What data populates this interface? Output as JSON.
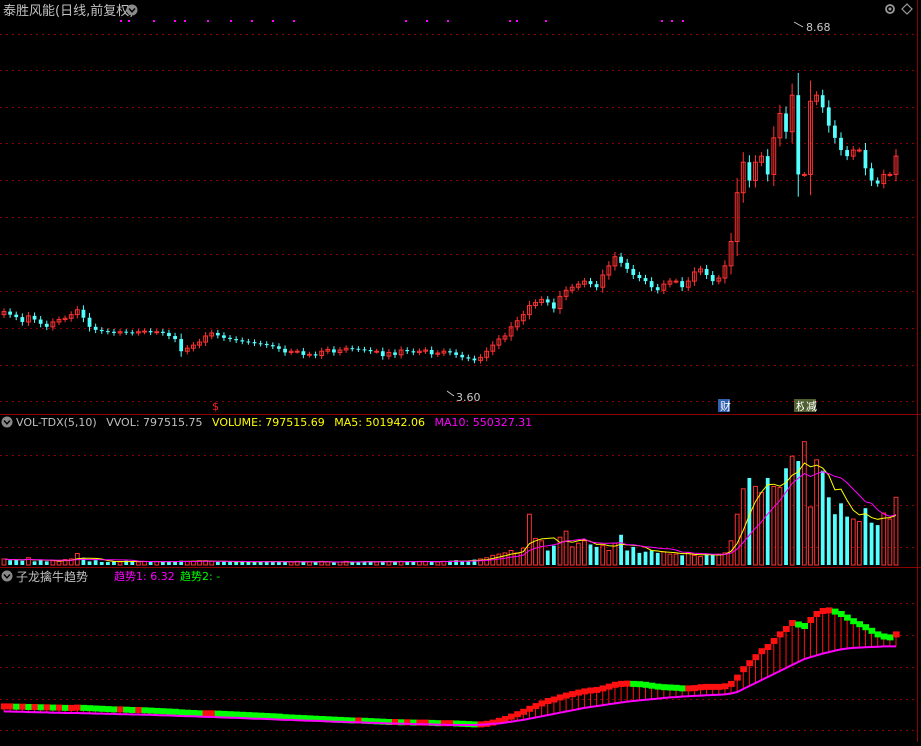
{
  "header": {
    "title": "泰胜风能(日线,前复权)",
    "right_icons": [
      "gear-icon",
      "diamond-icon"
    ]
  },
  "price_panel": {
    "high_label": "8.68",
    "low_label": "3.60",
    "events": [
      {
        "label": "$",
        "color": "#ff2020"
      },
      {
        "label": "财",
        "color": "#ffffff"
      },
      {
        "label": "权",
        "color": "#ffffff"
      },
      {
        "label": "减",
        "color": "#ffffff"
      }
    ]
  },
  "vol_panel": {
    "title": "VOL-TDX(5,10)",
    "vvol": "VVOL: 797515.75",
    "volume": "VOLUME: 797515.69",
    "ma5": "MA5: 501942.06",
    "ma10": "MA10: 550327.31"
  },
  "trend_panel": {
    "title": "子龙擒牛趋势",
    "trend1": "趋势1: 6.32",
    "trend2": "趋势2: -"
  },
  "colors": {
    "up": "#ff3232",
    "down": "#54ffff",
    "grid": "#8b0000",
    "ma5": "#ffff00",
    "ma10": "#ff00ff",
    "trend_line": "#ff00ff",
    "trend_up_box": "#ff1010",
    "trend_down_box": "#00ff00",
    "title_text": "#c0c0c0",
    "volume_text": "#ffff00",
    "trend2_text": "#00ff00"
  },
  "chart_data": [
    {
      "type": "candlestick",
      "name": "price",
      "ymin": 3.0,
      "ymax": 9.2,
      "series": [
        {
          "name": "close",
          "values": [
            4.45,
            4.4,
            4.36,
            4.28,
            4.38,
            4.32,
            4.25,
            4.2,
            4.28,
            4.32,
            4.34,
            4.4,
            4.48,
            4.35,
            4.2,
            4.15,
            4.13,
            4.12,
            4.1,
            4.12,
            4.11,
            4.1,
            4.12,
            4.13,
            4.11,
            4.12,
            4.1,
            4.05,
            4.0,
            3.8,
            3.85,
            3.9,
            3.95,
            4.05,
            4.1,
            4.06,
            4.02,
            4.0,
            3.98,
            3.96,
            3.95,
            3.93,
            3.92,
            3.9,
            3.88,
            3.84,
            3.78,
            3.8,
            3.8,
            3.74,
            3.75,
            3.73,
            3.8,
            3.83,
            3.78,
            3.82,
            3.85,
            3.84,
            3.83,
            3.82,
            3.8,
            3.8,
            3.72,
            3.78,
            3.74,
            3.82,
            3.8,
            3.78,
            3.8,
            3.82,
            3.75,
            3.77,
            3.8,
            3.78,
            3.74,
            3.7,
            3.68,
            3.65,
            3.7,
            3.8,
            3.9,
            4.0,
            4.05,
            4.2,
            4.3,
            4.4,
            4.55,
            4.6,
            4.65,
            4.6,
            4.5,
            4.7,
            4.8,
            4.85,
            4.9,
            4.95,
            4.9,
            4.85,
            5.05,
            5.2,
            5.35,
            5.25,
            5.15,
            5.05,
            5.0,
            4.95,
            4.85,
            4.8,
            4.9,
            4.95,
            4.95,
            4.85,
            4.95,
            5.1,
            5.15,
            5.05,
            4.95,
            5.0,
            5.2,
            5.6,
            6.4,
            6.9,
            6.6,
            6.9,
            7.0,
            6.7,
            7.3,
            7.7,
            7.4,
            8.0,
            6.7,
            6.7,
            7.9,
            8.0,
            7.8,
            7.5,
            7.3,
            7.1,
            7.0,
            7.1,
            7.1,
            6.8,
            6.6,
            6.55,
            6.7,
            6.7,
            7.0
          ]
        },
        {
          "name": "open",
          "values": [
            4.4,
            4.45,
            4.4,
            4.36,
            4.28,
            4.38,
            4.32,
            4.25,
            4.2,
            4.28,
            4.32,
            4.34,
            4.4,
            4.48,
            4.35,
            4.2,
            4.15,
            4.13,
            4.12,
            4.1,
            4.12,
            4.11,
            4.1,
            4.12,
            4.13,
            4.11,
            4.12,
            4.1,
            4.05,
            4.0,
            3.8,
            3.85,
            3.9,
            3.95,
            4.05,
            4.1,
            4.06,
            4.02,
            4.0,
            3.98,
            3.96,
            3.95,
            3.93,
            3.92,
            3.9,
            3.88,
            3.84,
            3.78,
            3.8,
            3.8,
            3.74,
            3.75,
            3.73,
            3.8,
            3.83,
            3.78,
            3.82,
            3.85,
            3.84,
            3.83,
            3.82,
            3.8,
            3.8,
            3.72,
            3.78,
            3.74,
            3.82,
            3.8,
            3.78,
            3.8,
            3.82,
            3.75,
            3.77,
            3.8,
            3.78,
            3.74,
            3.7,
            3.68,
            3.65,
            3.7,
            3.8,
            3.9,
            4.0,
            4.05,
            4.2,
            4.3,
            4.4,
            4.55,
            4.6,
            4.65,
            4.6,
            4.5,
            4.7,
            4.8,
            4.85,
            4.9,
            4.95,
            4.9,
            4.85,
            5.05,
            5.2,
            5.35,
            5.25,
            5.15,
            5.05,
            5.0,
            4.95,
            4.85,
            4.8,
            4.9,
            4.95,
            4.95,
            4.85,
            4.95,
            5.1,
            5.15,
            5.05,
            4.95,
            5.0,
            5.2,
            5.6,
            6.4,
            6.9,
            6.6,
            6.9,
            7.0,
            6.7,
            7.3,
            7.7,
            7.4,
            8.0,
            6.7,
            6.7,
            7.9,
            8.0,
            7.8,
            7.5,
            7.3,
            7.1,
            7.0,
            7.1,
            7.1,
            6.8,
            6.6,
            6.55,
            6.7,
            6.7
          ]
        }
      ]
    },
    {
      "type": "bar",
      "name": "volume",
      "ymax": 1100000,
      "series": [
        {
          "name": "VOLUME",
          "values": [
            50000,
            40000,
            45000,
            35000,
            60000,
            30000,
            40000,
            30000,
            35000,
            30000,
            45000,
            50000,
            95000,
            60000,
            30000,
            40000,
            25000,
            25000,
            30000,
            25000,
            35000,
            30000,
            25000,
            30000,
            25000,
            30000,
            25000,
            30000,
            30000,
            35000,
            30000,
            30000,
            35000,
            35000,
            30000,
            25000,
            30000,
            25000,
            25000,
            30000,
            25000,
            25000,
            30000,
            30000,
            30000,
            25000,
            25000,
            25000,
            30000,
            30000,
            25000,
            25000,
            30000,
            25000,
            20000,
            25000,
            30000,
            25000,
            25000,
            30000,
            30000,
            25000,
            30000,
            30000,
            25000,
            30000,
            30000,
            25000,
            30000,
            30000,
            30000,
            25000,
            30000,
            35000,
            40000,
            30000,
            35000,
            45000,
            50000,
            60000,
            80000,
            90000,
            100000,
            120000,
            100000,
            140000,
            420000,
            220000,
            200000,
            120000,
            160000,
            230000,
            280000,
            150000,
            180000,
            200000,
            170000,
            150000,
            160000,
            120000,
            180000,
            250000,
            120000,
            150000,
            100000,
            110000,
            120000,
            100000,
            110000,
            90000,
            90000,
            80000,
            100000,
            80000,
            70000,
            90000,
            85000,
            90000,
            100000,
            200000,
            420000,
            630000,
            720000,
            650000,
            600000,
            720000,
            650000,
            640000,
            800000,
            900000,
            860000,
            1020000,
            480000,
            870000,
            780000,
            560000,
            420000,
            510000,
            400000,
            380000,
            360000,
            470000,
            350000,
            330000,
            430000,
            380000,
            560000
          ]
        }
      ]
    },
    {
      "type": "line",
      "name": "trend",
      "ymin": 3.2,
      "ymax": 8.2,
      "series": [
        {
          "name": "趋势1",
          "values": [
            4.15,
            4.15,
            4.14,
            4.14,
            4.13,
            4.13,
            4.12,
            4.12,
            4.11,
            4.11,
            4.1,
            4.1,
            4.1,
            4.09,
            4.09,
            4.08,
            4.08,
            4.07,
            4.07,
            4.06,
            4.06,
            4.05,
            4.05,
            4.04,
            4.04,
            4.03,
            4.02,
            4.02,
            4.01,
            4.0,
            3.99,
            3.99,
            3.98,
            3.97,
            3.97,
            3.96,
            3.95,
            3.94,
            3.94,
            3.93,
            3.92,
            3.91,
            3.91,
            3.9,
            3.89,
            3.88,
            3.87,
            3.87,
            3.86,
            3.85,
            3.84,
            3.84,
            3.83,
            3.82,
            3.81,
            3.81,
            3.8,
            3.79,
            3.79,
            3.78,
            3.77,
            3.77,
            3.76,
            3.75,
            3.75,
            3.74,
            3.74,
            3.73,
            3.73,
            3.72,
            3.72,
            3.71,
            3.71,
            3.7,
            3.7,
            3.7,
            3.7,
            3.7,
            3.71,
            3.72,
            3.74,
            3.75,
            3.78,
            3.81,
            3.84,
            3.87,
            3.91,
            3.95,
            3.99,
            4.03,
            4.07,
            4.11,
            4.15,
            4.19,
            4.23,
            4.27,
            4.3,
            4.33,
            4.36,
            4.39,
            4.42,
            4.45,
            4.48,
            4.5,
            4.52,
            4.54,
            4.56,
            4.58,
            4.6,
            4.62,
            4.63,
            4.65,
            4.66,
            4.67,
            4.68,
            4.69,
            4.7,
            4.71,
            4.72,
            4.75,
            4.8,
            4.9,
            5.0,
            5.1,
            5.2,
            5.3,
            5.4,
            5.5,
            5.6,
            5.7,
            5.8,
            5.9,
            5.96,
            6.02,
            6.08,
            6.13,
            6.18,
            6.22,
            6.25,
            6.27,
            6.28,
            6.29,
            6.3,
            6.31,
            6.32,
            6.32,
            6.32
          ]
        },
        {
          "name": "趋势2",
          "values": [
            4.32,
            4.32,
            4.31,
            4.31,
            4.3,
            4.3,
            4.29,
            4.29,
            4.28,
            4.28,
            4.27,
            4.27,
            4.28,
            4.27,
            4.26,
            4.25,
            4.24,
            4.23,
            4.22,
            4.22,
            4.21,
            4.2,
            4.2,
            4.19,
            4.18,
            4.17,
            4.16,
            4.15,
            4.14,
            4.12,
            4.11,
            4.1,
            4.09,
            4.09,
            4.09,
            4.08,
            4.07,
            4.06,
            4.05,
            4.04,
            4.03,
            4.02,
            4.01,
            4.0,
            3.99,
            3.98,
            3.96,
            3.95,
            3.94,
            3.93,
            3.92,
            3.91,
            3.9,
            3.89,
            3.88,
            3.87,
            3.86,
            3.85,
            3.85,
            3.84,
            3.83,
            3.82,
            3.81,
            3.8,
            3.8,
            3.79,
            3.79,
            3.78,
            3.78,
            3.78,
            3.77,
            3.76,
            3.76,
            3.76,
            3.75,
            3.74,
            3.73,
            3.72,
            3.72,
            3.74,
            3.78,
            3.84,
            3.9,
            3.98,
            4.06,
            4.14,
            4.24,
            4.33,
            4.42,
            4.5,
            4.55,
            4.62,
            4.68,
            4.73,
            4.78,
            4.82,
            4.85,
            4.87,
            4.92,
            4.98,
            5.04,
            5.07,
            5.08,
            5.07,
            5.06,
            5.04,
            5.01,
            4.98,
            4.96,
            4.95,
            4.94,
            4.92,
            4.92,
            4.93,
            4.96,
            4.97,
            4.97,
            4.97,
            4.99,
            5.07,
            5.28,
            5.56,
            5.76,
            5.96,
            6.16,
            6.3,
            6.5,
            6.72,
            6.9,
            7.1,
            7.05,
            7.0,
            7.2,
            7.4,
            7.5,
            7.52,
            7.48,
            7.4,
            7.28,
            7.16,
            7.06,
            6.96,
            6.84,
            6.72,
            6.65,
            6.62,
            6.72
          ]
        }
      ]
    }
  ]
}
